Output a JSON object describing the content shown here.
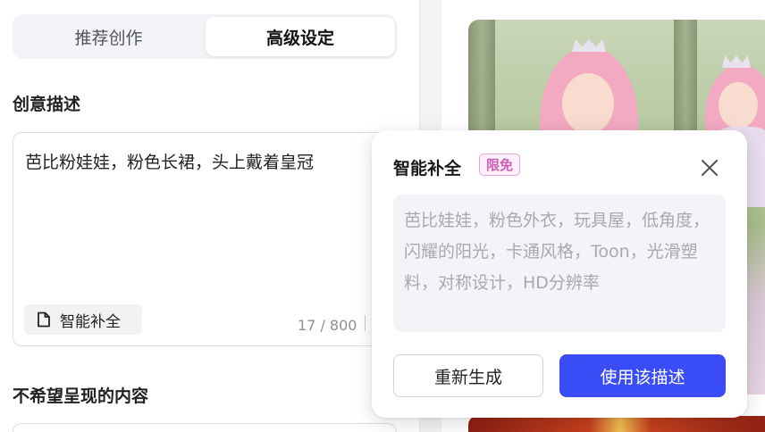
{
  "tabs": [
    {
      "label": "推荐创作",
      "active": false
    },
    {
      "label": "高级设定",
      "active": true
    }
  ],
  "description": {
    "title": "创意描述",
    "value": "芭比粉娃娃，粉色长裙，头上戴着皇冠",
    "smart_fill_label": "智能补全",
    "counter": "17 / 800"
  },
  "negative": {
    "title": "不希望呈现的内容"
  },
  "popover": {
    "title": "智能补全",
    "badge": "限免",
    "suggestion": "芭比娃娃，粉色外衣，玩具屋，低角度，闪耀的阳光，卡通风格，Toon，光滑塑料，对称设计，HD分辨率",
    "regenerate_label": "重新生成",
    "use_label": "使用该描述"
  },
  "colors": {
    "primary": "#3a4cf5",
    "badge": "#cf5fb4"
  },
  "icons": {
    "smart_fill": "document-icon",
    "close": "close-icon"
  }
}
